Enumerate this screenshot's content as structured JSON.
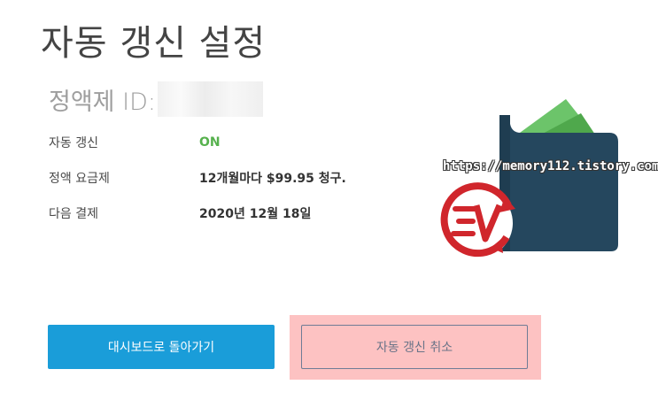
{
  "page": {
    "title": "자동 갱신 설정",
    "subscription_id_label": "정액제 ID:"
  },
  "details": [
    {
      "label": "자동 갱신",
      "value": "ON"
    },
    {
      "label": "정액 요금제",
      "value": "12개월마다 $99.95 청구."
    },
    {
      "label": "다음 결제",
      "value": "2020년 12월 18일"
    }
  ],
  "watermark": "https://memory112.tistory.com",
  "illustration": {
    "icons": [
      "wallet-icon",
      "expressvpn-logo"
    ]
  },
  "buttons": {
    "dashboard": "대시보드로 돌아가기",
    "cancel_autorenew": "자동 갱신 취소"
  },
  "colors": {
    "on_status": "#56b14d",
    "primary_button": "#1a9dd9",
    "highlight": "#fdc2c2",
    "wallet": "#25475e",
    "logo_red": "#d0262c"
  }
}
